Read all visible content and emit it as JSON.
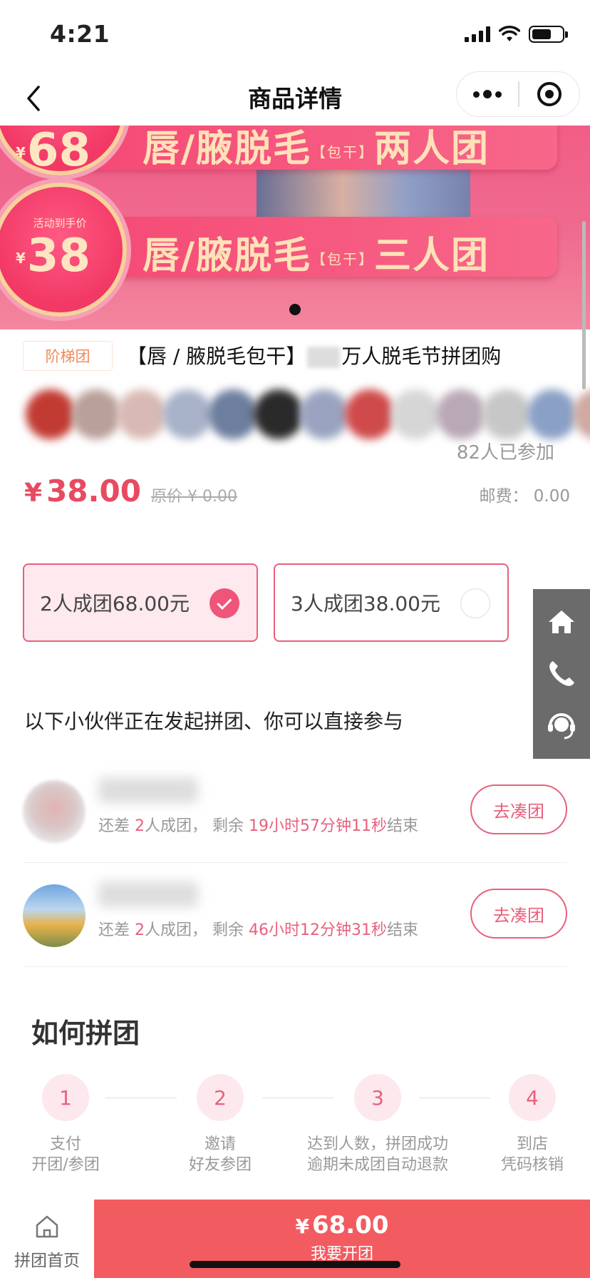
{
  "status": {
    "time": "4:21"
  },
  "nav": {
    "title": "商品详情"
  },
  "banner": {
    "top_strip": {
      "price": "68",
      "text": "唇/腋脱毛",
      "tag": "【包干】",
      "suffix": "两人团"
    },
    "bottom_strip": {
      "badge": "活动到手价",
      "price": "38",
      "text": "唇/腋脱毛",
      "tag": "【包干】",
      "suffix": "三人团"
    },
    "currency": "¥"
  },
  "product": {
    "tag": "阶梯团",
    "title_pre": "【唇 / 腋脱毛包干】",
    "title_post": "万人脱毛节拼团购",
    "joined": "82人已参加",
    "price_symbol": "¥",
    "price": "38.00",
    "original_price": "原价 ¥ 0.00",
    "shipping": "邮费： 0.00"
  },
  "options": [
    {
      "label": "2人成团68.00元",
      "selected": true
    },
    {
      "label": "3人成团38.00元",
      "selected": false
    }
  ],
  "side_buttons": [
    "home-icon",
    "phone-icon",
    "customer-service-icon"
  ],
  "groups": {
    "title": "以下小伙伴正在发起拼团、你可以直接参与",
    "items": [
      {
        "pre": "还差 ",
        "need": "2",
        "mid": "人成团， 剩余 ",
        "time": "19小时57分钟11秒",
        "post": "结束",
        "button": "去凑团"
      },
      {
        "pre": "还差 ",
        "need": "2",
        "mid": "人成团， 剩余 ",
        "time": "46小时12分钟31秒",
        "post": "结束",
        "button": "去凑团"
      }
    ]
  },
  "how": {
    "title": "如何拼团",
    "steps": [
      {
        "num": "1",
        "label": "支付\n开团/参团"
      },
      {
        "num": "2",
        "label": "邀请\n好友参团"
      },
      {
        "num": "3",
        "label": "达到人数，拼团成功\n逾期未成团自动退款"
      },
      {
        "num": "4",
        "label": "到店\n凭码核销"
      }
    ]
  },
  "bottom": {
    "home_label": "拼团首页",
    "buy_symbol": "¥",
    "buy_price": "68.00",
    "buy_label": "我要开团"
  },
  "colors": {
    "accent": "#e8607c",
    "buy": "#f25b60",
    "price": "#e84a5f"
  }
}
